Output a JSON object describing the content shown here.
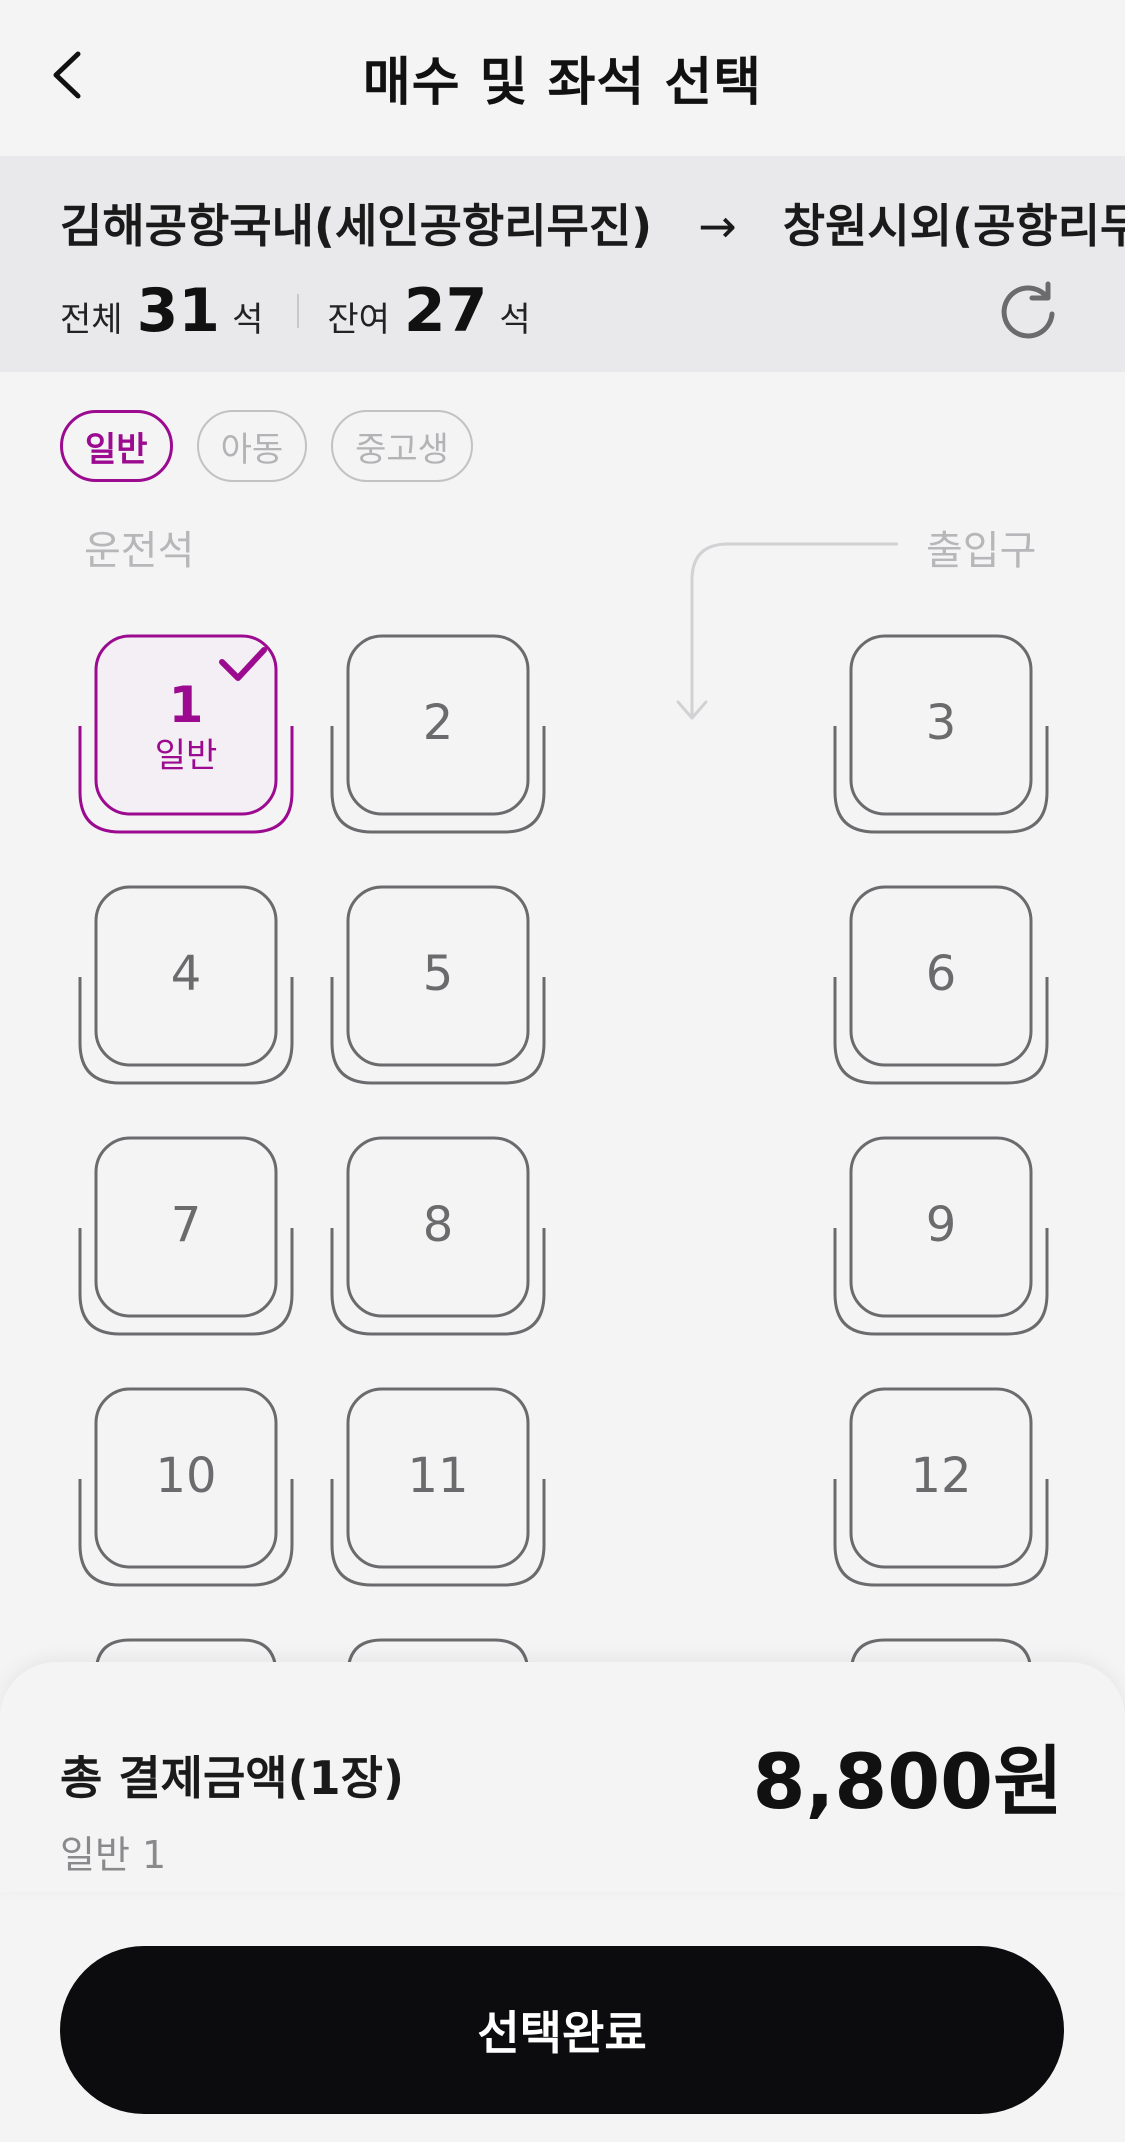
{
  "header": {
    "title": "매수 및 좌석 선택"
  },
  "route": {
    "origin": "김해공항국내(세인공항리무진)",
    "arrow": "→",
    "destination": "창원시외(공항리무진)"
  },
  "counts": {
    "total_label": "전체",
    "total": "31",
    "remaining_label": "잔여",
    "remaining": "27",
    "unit": "석"
  },
  "passenger_types": [
    "일반",
    "아동",
    "중고생"
  ],
  "selected_type": "일반",
  "layout_labels": {
    "driver": "운전석",
    "entrance": "출입구"
  },
  "seats": [
    {
      "number": "1",
      "selected": true,
      "type_label": "일반"
    },
    {
      "number": "2"
    },
    {
      "number": "3"
    },
    {
      "number": "4"
    },
    {
      "number": "5"
    },
    {
      "number": "6"
    },
    {
      "number": "7"
    },
    {
      "number": "8"
    },
    {
      "number": "9"
    },
    {
      "number": "10"
    },
    {
      "number": "11"
    },
    {
      "number": "12"
    }
  ],
  "summary": {
    "label": "총 결제금액(1장)",
    "price": "8,800원",
    "detail": "일반 1"
  },
  "confirm": {
    "label": "선택완료"
  },
  "colors": {
    "accent": "#9b0a8f",
    "seat_border": "#6b6b6e",
    "button_bg": "#0c0c0e"
  }
}
